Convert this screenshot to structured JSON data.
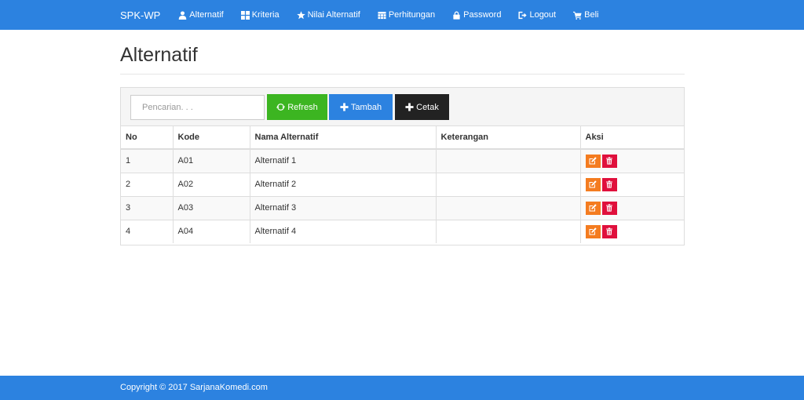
{
  "navbar": {
    "brand": "SPK-WP",
    "items": [
      {
        "label": "Alternatif",
        "icon": "user-icon"
      },
      {
        "label": "Kriteria",
        "icon": "grid-icon"
      },
      {
        "label": "Nilai Alternatif",
        "icon": "star-icon"
      },
      {
        "label": "Perhitungan",
        "icon": "calendar-icon"
      },
      {
        "label": "Password",
        "icon": "lock-icon"
      },
      {
        "label": "Logout",
        "icon": "logout-icon"
      },
      {
        "label": "Beli",
        "icon": "cart-icon"
      }
    ]
  },
  "page": {
    "title": "Alternatif"
  },
  "toolbar": {
    "search_placeholder": "Pencarian. . .",
    "refresh_label": "Refresh",
    "tambah_label": "Tambah",
    "cetak_label": "Cetak"
  },
  "table": {
    "headers": [
      "No",
      "Kode",
      "Nama Alternatif",
      "Keterangan",
      "Aksi"
    ],
    "rows": [
      {
        "no": "1",
        "kode": "A01",
        "nama": "Alternatif 1",
        "keterangan": ""
      },
      {
        "no": "2",
        "kode": "A02",
        "nama": "Alternatif 2",
        "keterangan": ""
      },
      {
        "no": "3",
        "kode": "A03",
        "nama": "Alternatif 3",
        "keterangan": ""
      },
      {
        "no": "4",
        "kode": "A04",
        "nama": "Alternatif 4",
        "keterangan": ""
      }
    ]
  },
  "footer": {
    "copyright": "Copyright © 2017 SarjanaKomedi.com"
  },
  "colors": {
    "primary": "#2c82e0",
    "success": "#3cb521",
    "dark": "#222222",
    "warning": "#f47c20",
    "danger": "#e0103c"
  }
}
